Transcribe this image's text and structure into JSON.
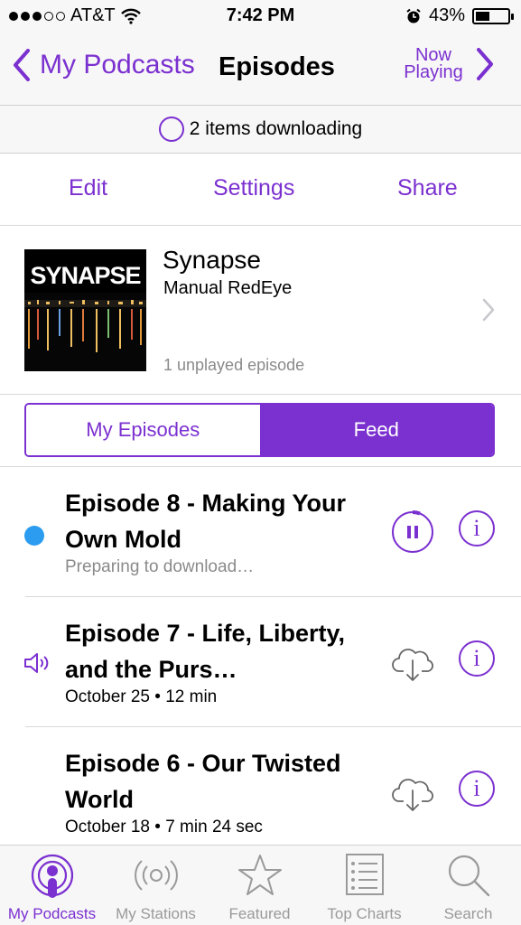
{
  "status_bar": {
    "carrier": "AT&T",
    "time": "7:42 PM",
    "battery": "43%",
    "battery_level": 0.43,
    "signal_bars": 3,
    "signal_total": 5
  },
  "nav": {
    "back_label": "My Podcasts",
    "title": "Episodes",
    "now_playing_line1": "Now",
    "now_playing_line2": "Playing"
  },
  "download_status": "2 items downloading",
  "actions": {
    "edit": "Edit",
    "settings": "Settings",
    "share": "Share"
  },
  "podcast": {
    "art_text": "SYNAPSE",
    "name": "Synapse",
    "author": "Manual RedEye",
    "unplayed": "1 unplayed episode"
  },
  "segments": {
    "my_episodes": "My Episodes",
    "feed": "Feed",
    "selected": "Feed"
  },
  "episodes": [
    {
      "title": "Episode 8 - Making Your Own Mold",
      "subtitle": "Preparing to download…",
      "state": "downloading",
      "indicator": "blue-dot",
      "action_icon": "pause-download-icon"
    },
    {
      "title": "Episode 7 - Life, Liberty, and the Purs…",
      "subtitle": "October 25 • 12 min",
      "state": "playing",
      "indicator": "speaker-icon",
      "action_icon": "cloud-download-icon"
    },
    {
      "title": "Episode 6 - Our Twisted World",
      "subtitle": "October 18 • 7 min 24 sec",
      "state": "available",
      "indicator": "none",
      "action_icon": "cloud-download-icon"
    }
  ],
  "tabs": [
    {
      "label": "My Podcasts",
      "icon": "podcast-icon",
      "active": true
    },
    {
      "label": "My Stations",
      "icon": "stations-icon",
      "active": false
    },
    {
      "label": "Featured",
      "icon": "star-icon",
      "active": false
    },
    {
      "label": "Top Charts",
      "icon": "list-icon",
      "active": false
    },
    {
      "label": "Search",
      "icon": "search-icon",
      "active": false
    }
  ],
  "colors": {
    "accent": "#7b30d0",
    "unplayed_dot": "#2b9cf0",
    "bar_background": "#f7f7f7",
    "inactive_tab": "#9a9a9a"
  }
}
